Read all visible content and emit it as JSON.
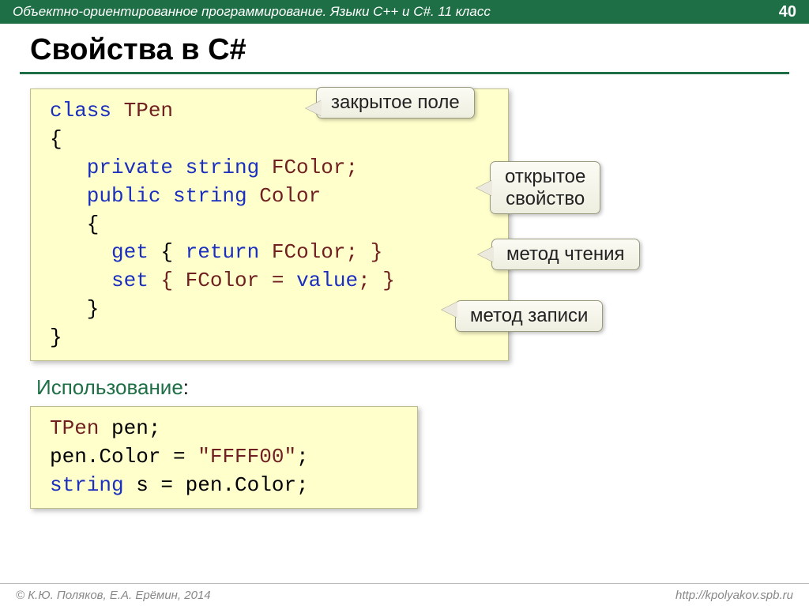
{
  "header": {
    "course_title": "Объектно-ориентированное программирование. Языки C++ и C#. 11 класс",
    "page_num": "40"
  },
  "main_title": "Свойства в C#",
  "code1": {
    "l1_kw": "class",
    "l1_name": " TPen",
    "l2": "{",
    "l3_kw": "   private string",
    "l3_rest": " FColor;",
    "l4_kw": "   public string",
    "l4_rest": " Color",
    "l5": "   {",
    "l6a": "     get",
    "l6b": " { ",
    "l6c": "return",
    "l6d": " FColor; }",
    "l7a": "     set",
    "l7b": " { FColor = ",
    "l7c": "value",
    "l7d": "; }",
    "l8": "   }",
    "l9": "}"
  },
  "callouts": {
    "c1": "закрытое поле",
    "c2a": "открытое",
    "c2b": "свойство",
    "c3": "метод чтения",
    "c4": "метод записи"
  },
  "subheading": "Использование",
  "code2": {
    "l1a": "TPen",
    "l1b": " pen;",
    "l2a": "pen.Color = ",
    "l2b": "\"FFFF00\"",
    "l2c": ";",
    "l3a": "string",
    "l3b": " s = pen.Color;"
  },
  "footer": {
    "left": "© К.Ю. Поляков, Е.А. Ерёмин, 2014",
    "right": "http://kpolyakov.spb.ru"
  }
}
